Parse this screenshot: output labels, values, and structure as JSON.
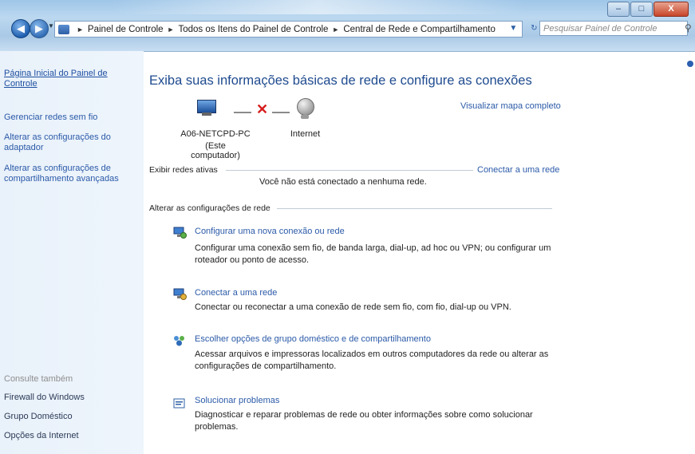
{
  "window": {
    "controls": {
      "minimize": "–",
      "maximize": "□",
      "close": "X"
    }
  },
  "address_bar": {
    "nav_back_icon": "arrow-left-icon",
    "nav_forward_icon": "arrow-right-icon",
    "path": [
      "Painel de Controle",
      "Todos os Itens do Painel de Controle",
      "Central de Rede e Compartilhamento"
    ],
    "refresh_symbol": "↻",
    "search_placeholder": "Pesquisar Painel de Controle"
  },
  "sidebar": {
    "home_link": "Página Inicial do Painel de Controle",
    "links": [
      "Gerenciar redes sem fio",
      "Alterar as configurações do adaptador",
      "Alterar as configurações de compartilhamento avançadas"
    ],
    "see_also_label": "Consulte também",
    "see_also": [
      "Firewall do Windows",
      "Grupo Doméstico",
      "Opções da Internet"
    ]
  },
  "main": {
    "title": "Exiba suas informações básicas de rede e configure as conexões",
    "map_link": "Visualizar mapa completo",
    "computer_label": "A06-NETCPD-PC",
    "computer_sublabel": "(Este computador)",
    "internet_label": "Internet",
    "active_networks_label": "Exibir redes ativas",
    "connect_link": "Conectar a uma rede",
    "status_text": "Você não está conectado a nenhuma rede.",
    "change_settings_label": "Alterar as configurações de rede",
    "tasks": [
      {
        "title": "Configurar uma nova conexão ou rede",
        "desc": "Configurar uma conexão sem fio, de banda larga, dial-up, ad hoc ou VPN; ou configurar um roteador ou ponto de acesso.",
        "icon": "network-setup-icon"
      },
      {
        "title": "Conectar a uma rede",
        "desc": "Conectar ou reconectar a uma conexão de rede sem fio, com fio, dial-up ou VPN.",
        "icon": "connect-network-icon"
      },
      {
        "title": "Escolher opções de grupo doméstico e de compartilhamento",
        "desc": "Acessar arquivos e impressoras localizados em outros computadores da rede ou alterar as configurações de compartilhamento.",
        "icon": "homegroup-icon"
      },
      {
        "title": "Solucionar problemas",
        "desc": "Diagnosticar e reparar problemas de rede ou obter informações sobre como solucionar problemas.",
        "icon": "troubleshoot-icon"
      }
    ]
  }
}
